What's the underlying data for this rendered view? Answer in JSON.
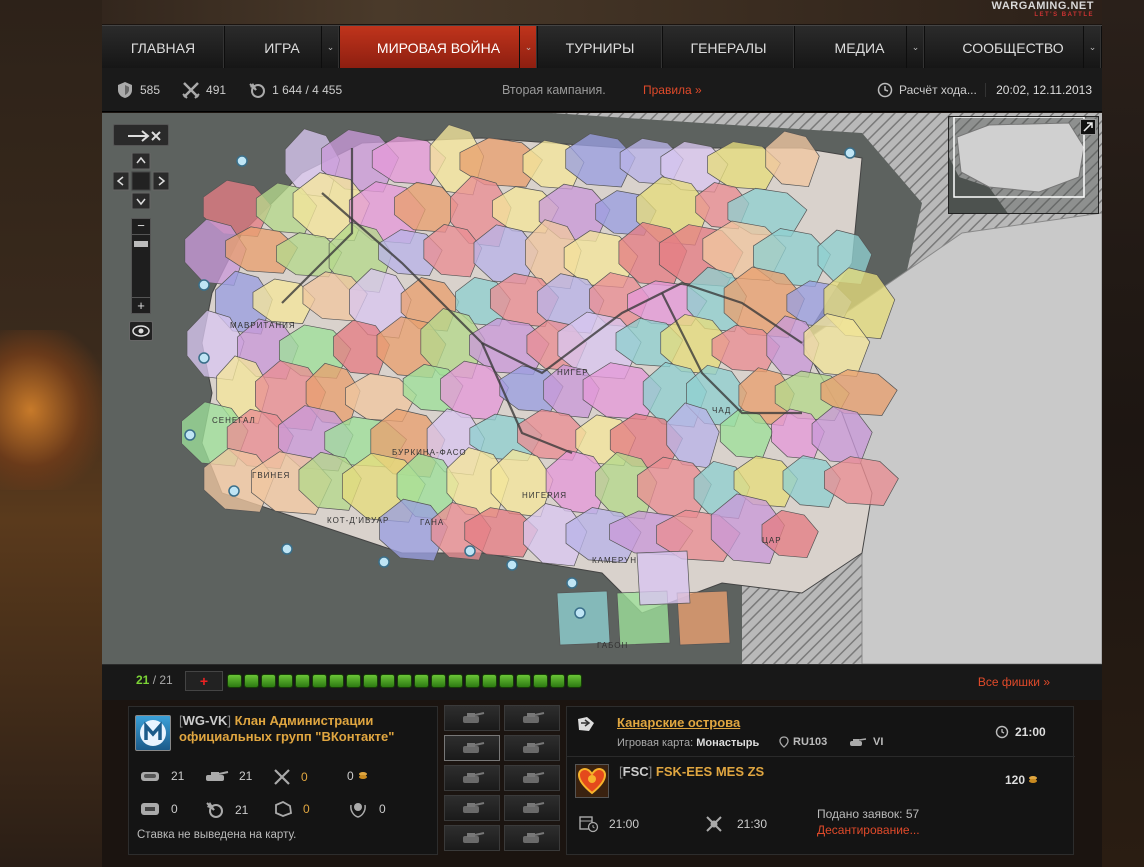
{
  "logo": {
    "name": "WARGAMING.NET",
    "tagline": "LET'S BATTLE"
  },
  "nav": {
    "items": [
      {
        "label": "ГЛАВНАЯ",
        "dropdown": false,
        "active": false
      },
      {
        "label": "ИГРА",
        "dropdown": true,
        "active": false
      },
      {
        "label": "МИРОВАЯ ВОЙНА",
        "dropdown": true,
        "active": true
      },
      {
        "label": "ТУРНИРЫ",
        "dropdown": false,
        "active": false
      },
      {
        "label": "ГЕНЕРАЛЫ",
        "dropdown": false,
        "active": false
      },
      {
        "label": "МЕДИА",
        "dropdown": true,
        "active": false
      },
      {
        "label": "СООБЩЕСТВО",
        "dropdown": true,
        "active": false
      }
    ]
  },
  "status": {
    "provinces": "585",
    "battles": "491",
    "chips": "1 644",
    "chips_total": "/ 4 455",
    "campaign": "Вторая кампания.",
    "rules": "Правила »",
    "turn_calc": "Расчёт хода...",
    "datetime": "20:02, 12.11.2013"
  },
  "map": {
    "labels": [
      "МАВРИТАНИЯ",
      "НИГЕР",
      "ЧАД",
      "СЕНЕГАЛ",
      "ГВИНЕЯ",
      "БУРКИНА-ФАСО",
      "НИГЕРИЯ",
      "КОТ-Д'ИВУАР",
      "ГАНА",
      "КАМЕРУН",
      "ЦАР",
      "ГАБОН"
    ],
    "controls": {
      "zoom_in": "+",
      "zoom_out": "−"
    }
  },
  "chipbar": {
    "count_active": "21",
    "count_total": "/ 21",
    "add_label": "+",
    "chip_count": 21,
    "all_chips": "Все фишки »"
  },
  "clan": {
    "tag": "WG-VK",
    "name_line1": "Клан Администрации",
    "name_line2": "официальных групп \"ВКонтакте\"",
    "stats": {
      "tanks": "21",
      "tanks_battle": "21",
      "battles": "0",
      "gold": "0",
      "landing": "0",
      "turns": "21",
      "attacks": "0",
      "medals": "0"
    },
    "note": "Ставка не выведена на карту."
  },
  "province": {
    "title": "Канарские острова",
    "map_label": "Игровая карта:",
    "map_name": "Монастырь",
    "server": "RU103",
    "tier": "VI",
    "prime_time": "21:00",
    "owner_tag": "FSC",
    "owner_name": "FSK-EES MES ZS",
    "income": "120",
    "battle_time": "21:00",
    "landing_time": "21:30",
    "applications": "Подано заявок: 57",
    "landing_status": "Десантирование..."
  },
  "colors": {
    "accent": "#c0341c",
    "gold": "#e0a640",
    "chip_green": "#5ab530",
    "link_red": "#e04a2a"
  }
}
